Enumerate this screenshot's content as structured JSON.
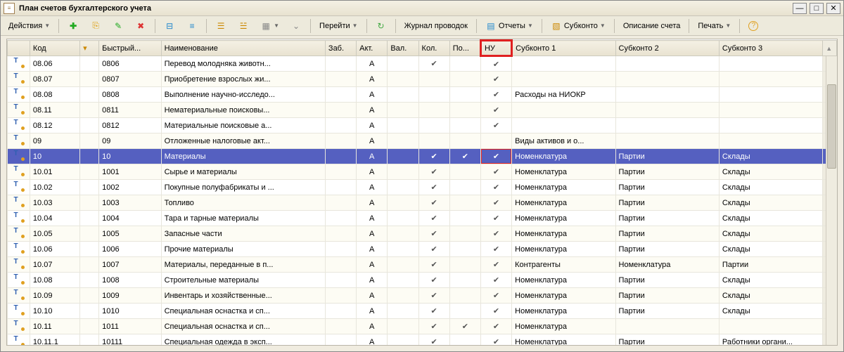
{
  "window": {
    "title": "План счетов бухгалтерского учета"
  },
  "toolbar": {
    "actions": "Действия",
    "goto": "Перейти",
    "journal": "Журнал проводок",
    "reports": "Отчеты",
    "subkonto": "Субконто",
    "descr": "Описание счета",
    "print": "Печать"
  },
  "columns": {
    "icon": "",
    "code": "Код",
    "sort": "",
    "quick": "Быстрый...",
    "name": "Наименование",
    "zab": "Заб.",
    "akt": "Акт.",
    "val": "Вал.",
    "kol": "Кол.",
    "po": "По...",
    "nu": "НУ",
    "sub1": "Субконто 1",
    "sub2": "Субконто 2",
    "sub3": "Субконто 3"
  },
  "rows": [
    {
      "code": "08.06",
      "quick": "0806",
      "name": "Перевод молодняка животн...",
      "akt": "А",
      "val": "",
      "kol": "✔",
      "po": "",
      "nu": "✔",
      "s1": "",
      "s2": "",
      "s3": ""
    },
    {
      "code": "08.07",
      "quick": "0807",
      "name": "Приобретение взрослых жи...",
      "akt": "А",
      "val": "",
      "kol": "",
      "po": "",
      "nu": "✔",
      "s1": "",
      "s2": "",
      "s3": ""
    },
    {
      "code": "08.08",
      "quick": "0808",
      "name": "Выполнение научно-исследо...",
      "akt": "А",
      "val": "",
      "kol": "",
      "po": "",
      "nu": "✔",
      "s1": "Расходы на НИОКР",
      "s2": "",
      "s3": ""
    },
    {
      "code": "08.11",
      "quick": "0811",
      "name": "Нематериальные поисковы...",
      "akt": "А",
      "val": "",
      "kol": "",
      "po": "",
      "nu": "✔",
      "s1": "",
      "s2": "",
      "s3": ""
    },
    {
      "code": "08.12",
      "quick": "0812",
      "name": "Материальные поисковые а...",
      "akt": "А",
      "val": "",
      "kol": "",
      "po": "",
      "nu": "✔",
      "s1": "",
      "s2": "",
      "s3": ""
    },
    {
      "code": "09",
      "quick": "09",
      "name": "Отложенные налоговые акт...",
      "akt": "А",
      "val": "",
      "kol": "",
      "po": "",
      "nu": "",
      "s1": "Виды активов и о...",
      "s2": "",
      "s3": ""
    },
    {
      "code": "10",
      "quick": "10",
      "name": "Материалы",
      "akt": "А",
      "val": "",
      "kol": "✔",
      "po": "✔",
      "nu": "✔",
      "s1": "Номенклатура",
      "s2": "Партии",
      "s3": "Склады",
      "selected": true,
      "nuHighlight": true
    },
    {
      "code": "10.01",
      "quick": "1001",
      "name": "Сырье и материалы",
      "akt": "А",
      "val": "",
      "kol": "✔",
      "po": "",
      "nu": "✔",
      "s1": "Номенклатура",
      "s2": "Партии",
      "s3": "Склады"
    },
    {
      "code": "10.02",
      "quick": "1002",
      "name": "Покупные полуфабрикаты и ...",
      "akt": "А",
      "val": "",
      "kol": "✔",
      "po": "",
      "nu": "✔",
      "s1": "Номенклатура",
      "s2": "Партии",
      "s3": "Склады"
    },
    {
      "code": "10.03",
      "quick": "1003",
      "name": "Топливо",
      "akt": "А",
      "val": "",
      "kol": "✔",
      "po": "",
      "nu": "✔",
      "s1": "Номенклатура",
      "s2": "Партии",
      "s3": "Склады"
    },
    {
      "code": "10.04",
      "quick": "1004",
      "name": "Тара и тарные материалы",
      "akt": "А",
      "val": "",
      "kol": "✔",
      "po": "",
      "nu": "✔",
      "s1": "Номенклатура",
      "s2": "Партии",
      "s3": "Склады"
    },
    {
      "code": "10.05",
      "quick": "1005",
      "name": "Запасные части",
      "akt": "А",
      "val": "",
      "kol": "✔",
      "po": "",
      "nu": "✔",
      "s1": "Номенклатура",
      "s2": "Партии",
      "s3": "Склады"
    },
    {
      "code": "10.06",
      "quick": "1006",
      "name": "Прочие материалы",
      "akt": "А",
      "val": "",
      "kol": "✔",
      "po": "",
      "nu": "✔",
      "s1": "Номенклатура",
      "s2": "Партии",
      "s3": "Склады"
    },
    {
      "code": "10.07",
      "quick": "1007",
      "name": "Материалы, переданные в п...",
      "akt": "А",
      "val": "",
      "kol": "✔",
      "po": "",
      "nu": "✔",
      "s1": "Контрагенты",
      "s2": "Номенклатура",
      "s3": "Партии"
    },
    {
      "code": "10.08",
      "quick": "1008",
      "name": "Строительные материалы",
      "akt": "А",
      "val": "",
      "kol": "✔",
      "po": "",
      "nu": "✔",
      "s1": "Номенклатура",
      "s2": "Партии",
      "s3": "Склады"
    },
    {
      "code": "10.09",
      "quick": "1009",
      "name": "Инвентарь и хозяйственные...",
      "akt": "А",
      "val": "",
      "kol": "✔",
      "po": "",
      "nu": "✔",
      "s1": "Номенклатура",
      "s2": "Партии",
      "s3": "Склады"
    },
    {
      "code": "10.10",
      "quick": "1010",
      "name": "Специальная оснастка и сп...",
      "akt": "А",
      "val": "",
      "kol": "✔",
      "po": "",
      "nu": "✔",
      "s1": "Номенклатура",
      "s2": "Партии",
      "s3": "Склады"
    },
    {
      "code": "10.11",
      "quick": "1011",
      "name": "Специальная оснастка и сп...",
      "akt": "А",
      "val": "",
      "kol": "✔",
      "po": "✔",
      "nu": "✔",
      "s1": "Номенклатура",
      "s2": "",
      "s3": ""
    },
    {
      "code": "10.11.1",
      "quick": "10111",
      "name": "Специальная одежда в эксп...",
      "akt": "А",
      "val": "",
      "kol": "✔",
      "po": "",
      "nu": "✔",
      "s1": "Номенклатура",
      "s2": "Партии",
      "s3": "Работники органи..."
    }
  ]
}
